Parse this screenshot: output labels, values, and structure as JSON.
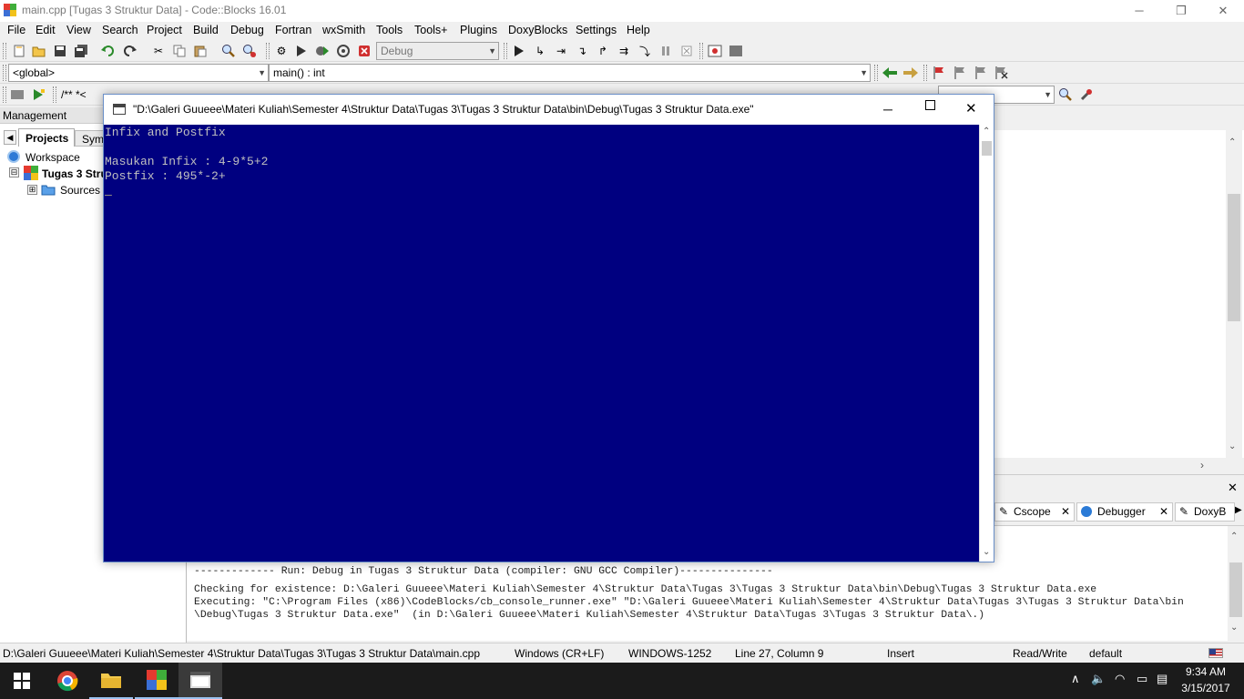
{
  "window": {
    "title": "main.cpp [Tugas 3 Struktur Data] - Code::Blocks 16.01",
    "controls": {
      "minimize": "─",
      "restore": "❐",
      "close": "✕"
    }
  },
  "menu": [
    "File",
    "Edit",
    "View",
    "Search",
    "Project",
    "Build",
    "Debug",
    "Fortran",
    "wxSmith",
    "Tools",
    "Tools+",
    "Plugins",
    "DoxyBlocks",
    "Settings",
    "Help"
  ],
  "toolbar": {
    "build_target": "Debug",
    "scope": "<global>",
    "function": "main() : int",
    "comment_label": "/** *<"
  },
  "management": {
    "header": "Management",
    "tabs": [
      "Projects",
      "Symb"
    ],
    "tree": [
      {
        "label": "Workspace",
        "expander": ""
      },
      {
        "label": "Tugas 3 Stru",
        "expander": "⊟"
      },
      {
        "label": "Sources",
        "expander": "⊞"
      }
    ]
  },
  "logs": {
    "tabs": [
      "Cscope",
      "Debugger",
      "DoxyB"
    ],
    "lines": [
      "------------- Run: Debug in Tugas 3 Struktur Data (compiler: GNU GCC Compiler)---------------",
      "Checking for existence: D:\\Galeri Guueee\\Materi Kuliah\\Semester 4\\Struktur Data\\Tugas 3\\Tugas 3 Struktur Data\\bin\\Debug\\Tugas 3 Struktur Data.exe",
      "Executing: \"C:\\Program Files (x86)\\CodeBlocks/cb_console_runner.exe\" \"D:\\Galeri Guueee\\Materi Kuliah\\Semester 4\\Struktur Data\\Tugas 3\\Tugas 3 Struktur Data\\bin",
      "\\Debug\\Tugas 3 Struktur Data.exe\"  (in D:\\Galeri Guueee\\Materi Kuliah\\Semester 4\\Struktur Data\\Tugas 3\\Tugas 3 Struktur Data\\.)"
    ]
  },
  "status": {
    "path": "D:\\Galeri Guueee\\Materi Kuliah\\Semester 4\\Struktur Data\\Tugas 3\\Tugas 3 Struktur Data\\main.cpp",
    "eol": "Windows (CR+LF)",
    "encoding": "WINDOWS-1252",
    "position": "Line 27, Column 9",
    "mode": "Insert",
    "access": "Read/Write",
    "profile": "default"
  },
  "console": {
    "title": "\"D:\\Galeri Guueee\\Materi Kuliah\\Semester 4\\Struktur Data\\Tugas 3\\Tugas 3 Struktur Data\\bin\\Debug\\Tugas 3 Struktur Data.exe\"",
    "lines": [
      "Infix and Postfix",
      "",
      "Masukan Infix : 4-9*5+2",
      "Postfix : 495*-2+"
    ],
    "cursor": "_",
    "bg_color": "#000080"
  },
  "taskbar": {
    "time": "9:34 AM",
    "date": "3/15/2017"
  }
}
